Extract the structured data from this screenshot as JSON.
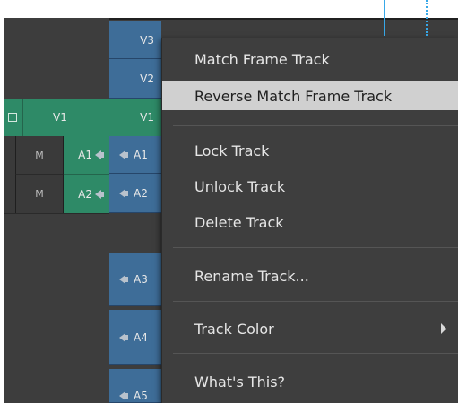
{
  "tracks": {
    "video_dest": [
      "V3",
      "V2",
      "V1"
    ],
    "source_v1": "V1",
    "source_mute": [
      "M",
      "M"
    ],
    "source_audio": [
      "A1",
      "A2"
    ],
    "audio_dest": [
      "A1",
      "A2",
      "A3",
      "A4",
      "A5"
    ]
  },
  "context_menu": {
    "items": [
      {
        "label": "Match Frame Track"
      },
      {
        "label": "Reverse Match Frame Track"
      },
      {
        "label": "Lock Track"
      },
      {
        "label": "Unlock Track"
      },
      {
        "label": "Delete Track"
      },
      {
        "label": "Rename Track..."
      },
      {
        "label": "Track Color"
      },
      {
        "label": "What's This?"
      }
    ],
    "highlighted": "Reverse Match Frame Track",
    "submenu_item": "Track Color"
  },
  "colors": {
    "video_source": "#2e8a67",
    "track_blue": "#3e6d98",
    "menu_bg": "#3e3e3e",
    "highlight": "#d0d0d0",
    "ruler": "#38a8e8"
  }
}
